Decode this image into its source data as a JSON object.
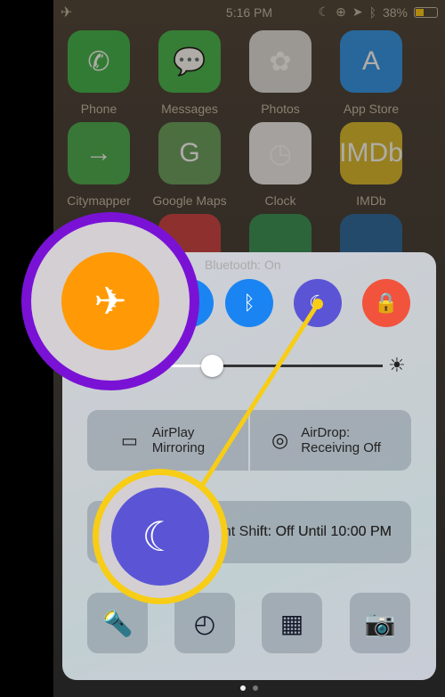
{
  "status": {
    "time": "5:16 PM",
    "battery": "38%",
    "battery_level": 0.38
  },
  "apps": [
    {
      "label": "Phone",
      "glyph": "✆",
      "color": "#2fae3d"
    },
    {
      "label": "Messages",
      "glyph": "💬",
      "color": "#35b03f"
    },
    {
      "label": "Photos",
      "glyph": "✿",
      "color": "#ddd"
    },
    {
      "label": "App Store",
      "glyph": "A",
      "color": "#1f8de8"
    },
    {
      "label": "Citymapper",
      "glyph": "→",
      "color": "#3aa842"
    },
    {
      "label": "Google Maps",
      "glyph": "G",
      "color": "#5c9a52"
    },
    {
      "label": "Clock",
      "glyph": "◷",
      "color": "#eee"
    },
    {
      "label": "IMDb",
      "glyph": "IMDb",
      "color": "#d8b61c"
    }
  ],
  "control_center": {
    "hint": "Bluetooth: On",
    "brightness": 0.4,
    "airplay": "AirPlay\nMirroring",
    "airdrop": "AirDrop:\nReceiving Off",
    "night_shift": "Night Shift: Off Until 10:00 PM",
    "night_shift_visible": "ift: Off Until 10:00 PM",
    "colors": {
      "airplane": "#ff9a06",
      "bluetooth": "#1a84f2",
      "dnd": "#5b55d6",
      "rotation": "#f2533d",
      "highlight_purple": "#7a12d6",
      "highlight_yellow": "#f7cd16"
    }
  }
}
